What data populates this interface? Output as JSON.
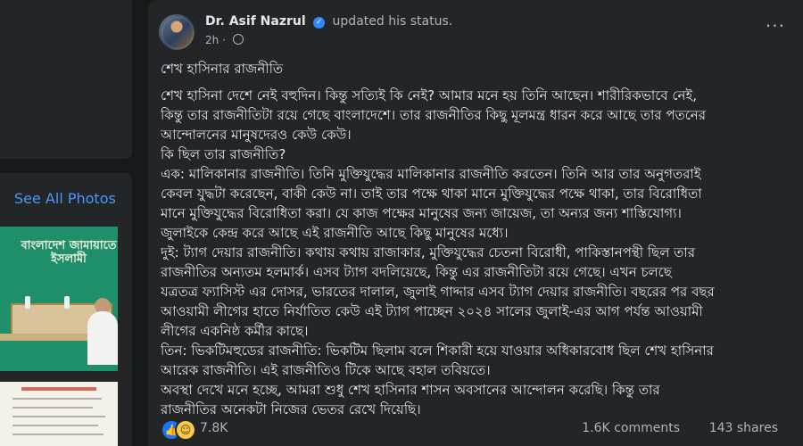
{
  "sidebar": {
    "see_all_photos": "See All Photos",
    "photo_banner_text": "বাংলাদেশ জামায়াতে ইসলামী"
  },
  "post": {
    "author": "Dr. Asif Nazrul",
    "status": "updated his status.",
    "time": "2h",
    "more": "···",
    "heading": "শেখ হাসিনার রাজনীতি",
    "lines": [
      "শেখ হাসিনা দেশে নেই বহুদিন। কিন্তু সত্যিই কি নেই? আমার মনে হয় তিনি আছেন। শারীরিকভাবে নেই,",
      "কিন্তু তার রাজনীতিটা রয়ে গেছে বাংলাদেশে। তার রাজনীতির কিছু মূলমন্ত্র ধারন করে আছে তার পতনের",
      "আন্দোলনের মানুষদেরও কেউ কেউ।",
      "কি ছিল তার রাজনীতি?",
      "এক: মালিকানার রাজনীতি। তিনি মুক্তিযুদ্ধের মালিকানার রাজনীতি করতেন। তিনি আর তার অনুগতরাই",
      "কেবল যুদ্ধটা করেছেন, বাকী কেউ না। তাই তার পক্ষে থাকা মানে মুক্তিযুদ্ধের পক্ষে থাকা, তার বিরোধিতা",
      "মানে মুক্তিযুদ্ধের বিরোধিতা করা। যে কাজ পক্ষের মানুষের জন্য জায়েজ, তা অন্যর জন্য শাস্তিযোগ্য।",
      "জুলাইকে কেন্দ্র করে আছে এই রাজনীতি আছে কিছু মানুষের মধ্যে।",
      "দুই: ট্যাগ দেয়ার রাজনীতি। কথায় কথায় রাজাকার, মুক্তিযুদ্ধের চেতনা বিরোধী, পাকিস্তানপন্থী ছিল তার",
      "রাজনীতির অন্যতম হলমার্ক। এসব ট্যাগ বদলিয়েছে, কিন্তু এর রাজনীতিটা রয়ে গেছে। এখন চলছে",
      "যত্রতত্র ফ্যাসিস্ট এর দোসর, ভারতের দালাল, জুলাই গাদ্দার এসব ট্যাগ দেয়ার রাজনীতি। বছরের পর বছর",
      "আওয়ামী লীগের হাতে নির্যাতিত কেউ এই ট্যাগ পাচ্ছেন ২০২৪ সালের জুলাই-এর আগ পর্যন্ত আওয়ামী",
      "লীগের একনিষ্ঠ কর্মীর কাছে।",
      "তিন: ভিকটিমহুডের রাজনীতি: ভিকটিম ছিলাম বলে শিকারী হয়ে যাওয়ার অধিকারবোধ ছিল শেখ হাসিনার",
      "আরেক রাজনীতি। এই রাজনীতিও টিকে আছে বহাল তবিয়তে।",
      "অবস্থা দেখে মনে হচ্ছে, আমরা শুধু শেখ হাসিনার শাসন অবসানের আন্দোলন করেছি। কিন্তু তার",
      "রাজনীতির অনেকটা নিজের ভেতর রেখে দিয়েছি।"
    ]
  },
  "footer": {
    "reactions_count": "7.8K",
    "comments": "1.6K comments",
    "shares": "143 shares"
  },
  "colors": {
    "background": "#18191a",
    "card": "#242526",
    "text": "#e4e6eb",
    "muted": "#b0b3b8",
    "link": "#4599ff",
    "verified": "#2d88ff"
  },
  "icons": [
    "verified-badge-icon",
    "globe-icon",
    "more-options-icon",
    "like-reaction-icon",
    "haha-reaction-icon"
  ]
}
